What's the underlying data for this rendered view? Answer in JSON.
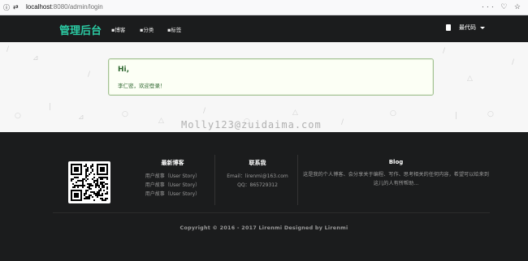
{
  "browser": {
    "host": "localhost",
    "path": ":8080/admin/login",
    "menu_dots": "···"
  },
  "navbar": {
    "brand": "管理后台",
    "links": [
      "▪博客",
      "▪分类",
      "▪标签"
    ],
    "user": "最代码"
  },
  "message": {
    "title": "Hi,",
    "text": "李仁密，欢迎登录！"
  },
  "watermark": "Molly123@zuidaima.com",
  "footer": {
    "latest": {
      "title": "最新博客",
      "items": [
        "用户故事（User Story）",
        "用户故事（User Story）",
        "用户故事（User Story）"
      ]
    },
    "contact": {
      "title": "联系我",
      "email": "Email：lirenmi@163.com",
      "qq": "QQ：865729312"
    },
    "blog": {
      "title": "Blog",
      "text": "这是我的个人博客、会分享关于编程、写作、思考相关的任何内容，希望可以给来到这儿的人有所帮助..."
    },
    "copyright": "Copyright © 2016 - 2017 Lirenmi Designed by Lirenmi"
  },
  "colors": {
    "brand": "#2bcaa3",
    "navbar_bg": "#1b1c1d",
    "success_bg": "#fcfff5",
    "success_text": "#2c662d"
  },
  "icons": [
    "info-icon",
    "site-icon",
    "document-icon",
    "caret-down-icon",
    "qr-code-icon"
  ]
}
